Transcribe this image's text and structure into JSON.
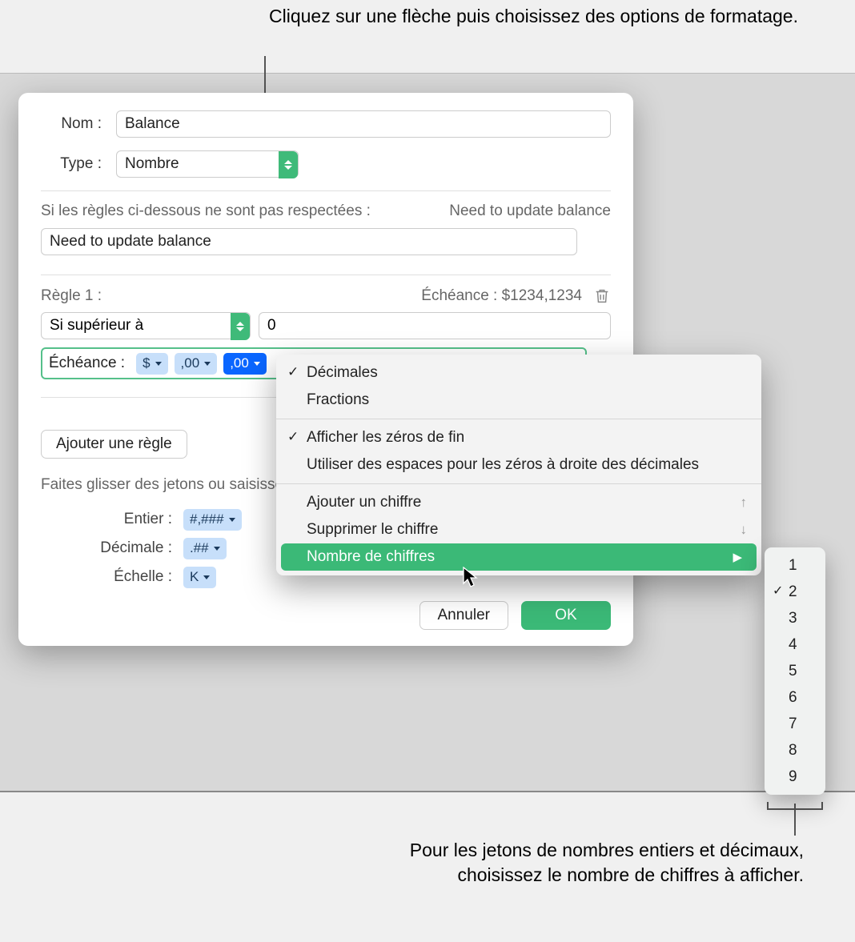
{
  "callouts": {
    "top": "Cliquez sur une flèche puis choisissez des options de formatage.",
    "bottom": "Pour les jetons de nombres entiers et décimaux, choisissez le nombre de chiffres à afficher."
  },
  "panel": {
    "name_label": "Nom :",
    "name_value": "Balance",
    "type_label": "Type :",
    "type_value": "Nombre",
    "rules_note": "Si les règles ci-dessous ne sont pas respectées :",
    "rules_preview": "Need to update balance",
    "rules_input": "Need to update balance",
    "rule1_label": "Règle 1 :",
    "rule1_preview": "Échéance : $1234,1234",
    "cond_value": "Si supérieur à",
    "cond_number": "0",
    "echeance_label": "Échéance :",
    "tokens": {
      "t1": "$",
      "t2": ",00",
      "t3": ",00"
    },
    "add_rule": "Ajouter une règle",
    "drag_hint": "Faites glisser des jetons ou saisissez",
    "tg": {
      "entier_label": "Entier :",
      "entier_token": "#,###",
      "decimale_label": "Décimale :",
      "decimale_token": ".##",
      "echelle_label": "Échelle :",
      "echelle_token": "K"
    },
    "cancel": "Annuler",
    "ok": "OK"
  },
  "menu": {
    "decimales": "Décimales",
    "fractions": "Fractions",
    "zeros_fin": "Afficher les zéros de fin",
    "espaces_zeros": "Utiliser des espaces pour les zéros à droite des décimales",
    "ajouter": "Ajouter un chiffre",
    "supprimer": "Supprimer le chiffre",
    "nombre": "Nombre de chiffres",
    "up_hint": "↑",
    "down_hint": "↓"
  },
  "submenu": {
    "items": [
      "1",
      "2",
      "3",
      "4",
      "5",
      "6",
      "7",
      "8",
      "9"
    ],
    "checked_index": 1
  }
}
